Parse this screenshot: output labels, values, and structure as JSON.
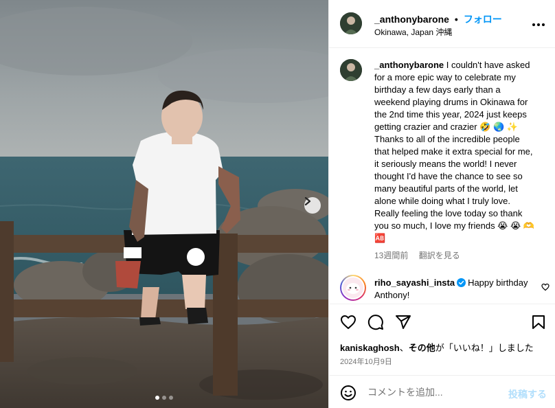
{
  "post": {
    "username": "_anthonybarone",
    "separator": "•",
    "follow_label": "フォロー",
    "location": "Okinawa, Japan 沖縄",
    "more_icon": "more-horizontal-icon"
  },
  "caption": {
    "username": "_anthonybarone",
    "text": "I couldn't have asked for a more epic way to celebrate my birthday a few days early than a weekend playing drums in Okinawa for the 2nd time this year, 2024 just keeps getting crazier and crazier 🤣 🌏 ✨ Thanks to all of the incredible people that helped make it extra special for me, it seriously means the world! I never thought I'd have the chance to see so many beautiful parts of the world, let alone while doing what I truly love. Really feeling the love today so thank you so much, I love my friends 😭 😭 🫶 🆎",
    "age": "13週間前",
    "translate_label": "翻訳を見る"
  },
  "comment": {
    "username": "riho_sayashi_insta",
    "text": "Happy birthday Anthony!",
    "verified_color": "#0095f6"
  },
  "likes": {
    "user": "kaniskaghosh",
    "connector": "、",
    "others": "その他",
    "suffix": "が「いいね！」しました"
  },
  "date": "2024年10月9日",
  "add_comment": {
    "placeholder": "コメントを追加...",
    "post_label": "投稿する"
  },
  "carousel": {
    "slide_count": 3,
    "active_slide": 1
  },
  "colors": {
    "accent": "#0095f6",
    "muted": "#737373",
    "post_disabled": "#b2dffc"
  }
}
